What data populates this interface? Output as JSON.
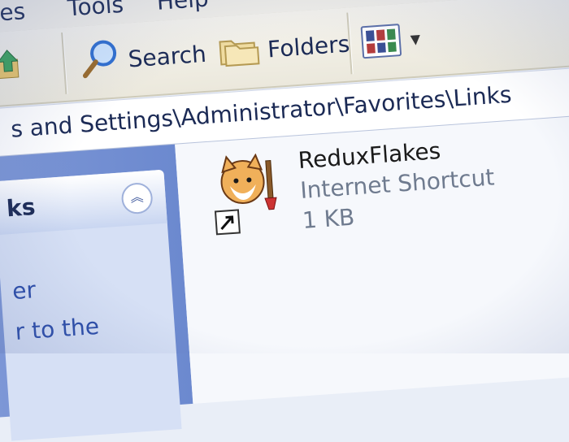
{
  "menubar": {
    "items": [
      "es",
      "Tools",
      "Help"
    ]
  },
  "toolbar": {
    "search_label": "Search",
    "folders_label": "Folders",
    "views_icon": "views-icon"
  },
  "address": {
    "path": "s and Settings\\Administrator\\Favorites\\Links"
  },
  "tasks": {
    "title": "ks",
    "links": [
      "er",
      "r to the"
    ]
  },
  "file": {
    "name": "ReduxFlakes",
    "type": "Internet Shortcut",
    "size": "1 KB",
    "icon": "shortcut-icon"
  },
  "colors": {
    "accent": "#3a4f95",
    "pane": "#7d97d6"
  }
}
